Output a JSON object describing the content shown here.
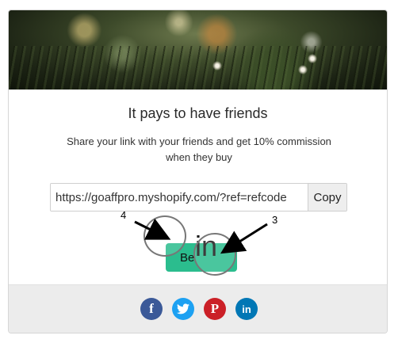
{
  "hero": {
    "image_alt": "grass field at dusk"
  },
  "title": "It pays to have friends",
  "description": "Share your link with your friends and get 10% commission when they buy",
  "referral": {
    "link_value": "https://goaffpro.myshopify.com/?ref=refcode",
    "copy_label": "Copy"
  },
  "become_button": {
    "label": "Be"
  },
  "overlay": {
    "big_icon_text": "in",
    "marker_left": "4",
    "marker_right": "3"
  },
  "social": [
    {
      "name": "facebook",
      "glyph": "f",
      "color": "#3b5998"
    },
    {
      "name": "twitter",
      "glyph": "t",
      "color": "#1da1f2"
    },
    {
      "name": "pinterest",
      "glyph": "P",
      "color": "#cb2027"
    },
    {
      "name": "linkedin",
      "glyph": "in",
      "color": "#0077b5"
    }
  ]
}
